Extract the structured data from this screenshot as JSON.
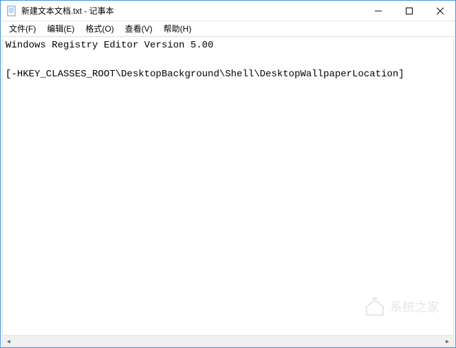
{
  "titlebar": {
    "title": "新建文本文档.txt - 记事本"
  },
  "menubar": {
    "items": [
      {
        "label": "文件(F)"
      },
      {
        "label": "编辑(E)"
      },
      {
        "label": "格式(O)"
      },
      {
        "label": "查看(V)"
      },
      {
        "label": "帮助(H)"
      }
    ]
  },
  "editor": {
    "content": "Windows Registry Editor Version 5.00\n\n[-HKEY_CLASSES_ROOT\\DesktopBackground\\Shell\\DesktopWallpaperLocation]\n"
  },
  "watermark": {
    "text": "系统之家"
  }
}
